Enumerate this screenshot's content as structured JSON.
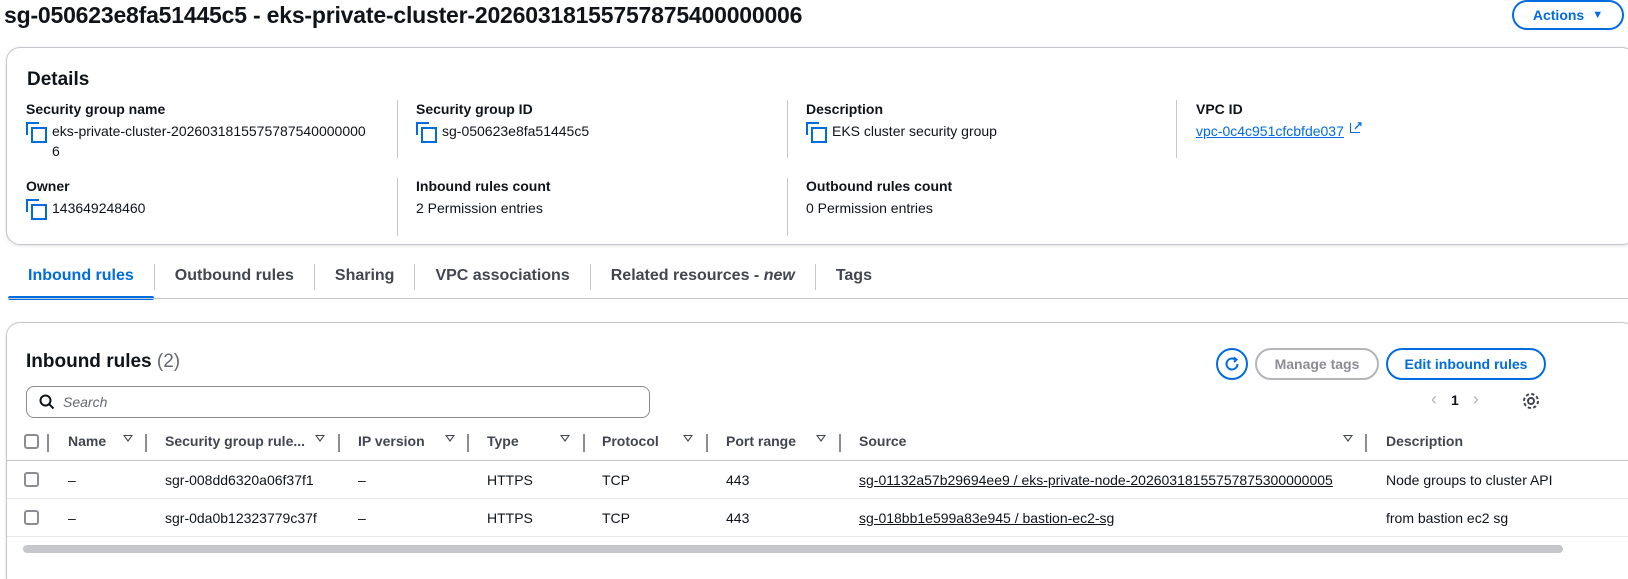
{
  "page": {
    "title": "sg-050623e8fa51445c5 - eks-private-cluster-20260318155757875400000006",
    "actions_label": "Actions"
  },
  "details": {
    "heading": "Details",
    "sg_name_label": "Security group name",
    "sg_name_line1": "eks-private-cluster-2026031815575787540000000",
    "sg_name_line2": "6",
    "sg_id_label": "Security group ID",
    "sg_id": "sg-050623e8fa51445c5",
    "description_label": "Description",
    "description": "EKS cluster security group",
    "vpc_label": "VPC ID",
    "vpc_id": "vpc-0c4c951cfcbfde037",
    "owner_label": "Owner",
    "owner": "143649248460",
    "inbound_count_label": "Inbound rules count",
    "inbound_count": "2 Permission entries",
    "outbound_count_label": "Outbound rules count",
    "outbound_count": "0 Permission entries"
  },
  "tabs": [
    {
      "label": "Inbound rules",
      "active": true
    },
    {
      "label": "Outbound rules"
    },
    {
      "label": "Sharing"
    },
    {
      "label": "VPC associations"
    },
    {
      "label": "Related resources - ",
      "suffix": "new"
    },
    {
      "label": "Tags"
    }
  ],
  "rules": {
    "title": "Inbound rules",
    "count": "(2)",
    "manage_tags_label": "Manage tags",
    "edit_label": "Edit inbound rules",
    "search_placeholder": "Search",
    "page_number": "1",
    "columns": [
      "Name",
      "Security group rule...",
      "IP version",
      "Type",
      "Protocol",
      "Port range",
      "Source",
      "Description"
    ],
    "rows": [
      {
        "name": "–",
        "rule_id": "sgr-008dd6320a06f37f1",
        "ip_version": "–",
        "type": "HTTPS",
        "protocol": "TCP",
        "port_range": "443",
        "source": "sg-01132a57b29694ee9 / eks-private-node-20260318155757875300000005",
        "description": "Node groups to cluster API"
      },
      {
        "name": "–",
        "rule_id": "sgr-0da0b12323779c37f",
        "ip_version": "–",
        "type": "HTTPS",
        "protocol": "TCP",
        "port_range": "443",
        "source": "sg-018bb1e599a83e945 / bastion-ec2-sg",
        "description": "from bastion ec2 sg"
      }
    ]
  },
  "colors": {
    "accent": "#006ce0",
    "text": "#0f141a",
    "border": "#c6c6cd"
  }
}
